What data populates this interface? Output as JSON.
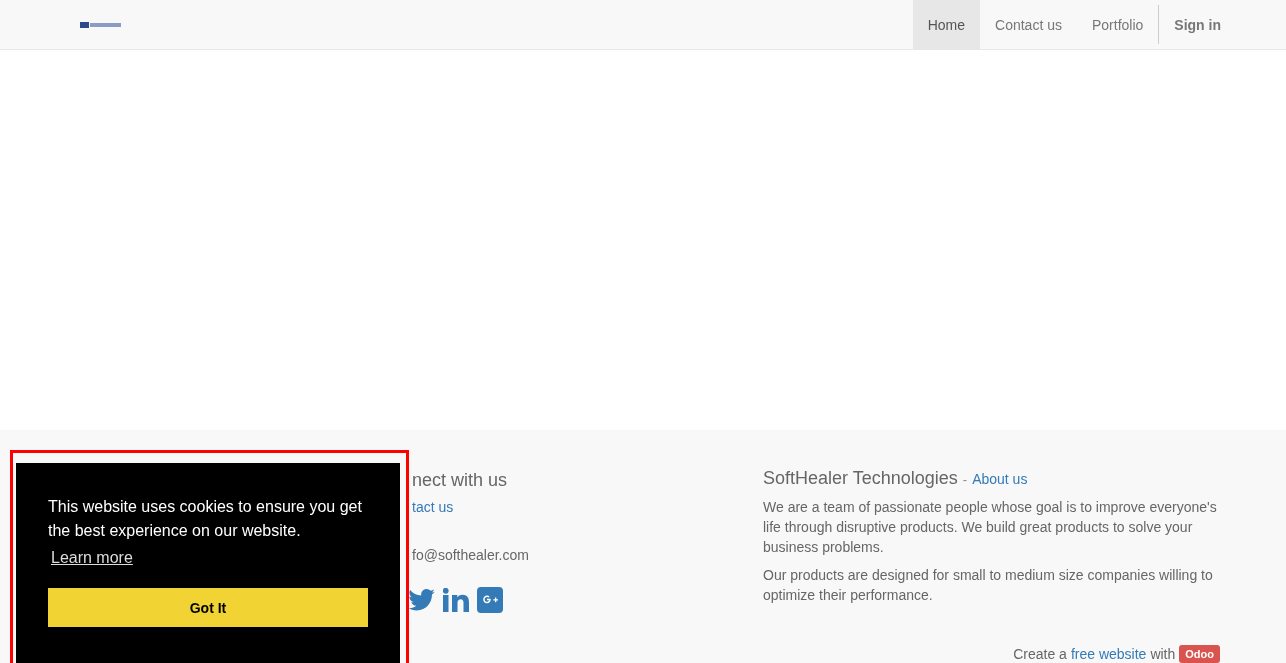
{
  "navbar": {
    "items": [
      {
        "label": "Home",
        "selected": true
      },
      {
        "label": "Contact us",
        "selected": false
      },
      {
        "label": "Portfolio",
        "selected": false
      }
    ],
    "sign_in": "Sign in"
  },
  "footer": {
    "connect": {
      "heading": "nect with us",
      "link": "tact us",
      "email": "fo@softhealer.com"
    },
    "about": {
      "title": "SoftHealer Technologies",
      "separator": "-",
      "link": "About us",
      "paragraphs": [
        "We are a team of passionate people whose goal is to improve everyone's life through disruptive products. We build great products to solve your business problems.",
        "Our products are designed for small to medium size companies willing to optimize their performance."
      ]
    },
    "credit": {
      "prefix": "Create a",
      "link": "free website",
      "middle": "with",
      "badge": "Odoo"
    }
  },
  "cookie_banner": {
    "message": "This website uses cookies to ensure you get the best experience on our website.",
    "link": "Learn more",
    "button": "Got It",
    "highlighted": true
  }
}
